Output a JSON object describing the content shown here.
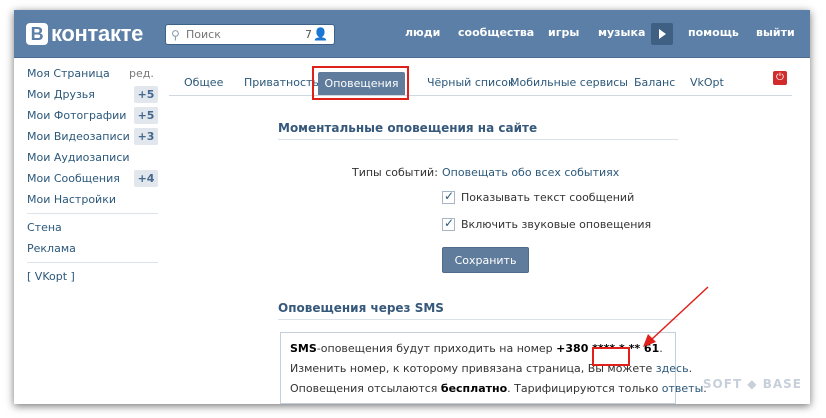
{
  "header": {
    "logo_letter": "В",
    "logo_text": "контакте",
    "search_placeholder": "Поиск",
    "search_count": "7",
    "nav": [
      "люди",
      "сообщества",
      "игры",
      "музыка",
      "помощь",
      "выйти"
    ]
  },
  "sidebar": {
    "edit_label": "ред.",
    "items": [
      {
        "label": "Моя Страница"
      },
      {
        "label": "Мои Друзья",
        "badge": "+5"
      },
      {
        "label": "Мои Фотографии",
        "badge": "+5"
      },
      {
        "label": "Мои Видеозаписи",
        "badge": "+3"
      },
      {
        "label": "Мои Аудиозаписи"
      },
      {
        "label": "Мои Сообщения",
        "badge": "+4"
      },
      {
        "label": "Мои Настройки"
      },
      {
        "label": "Стена"
      },
      {
        "label": "Реклама"
      },
      {
        "label": "[ VKopt ]"
      }
    ]
  },
  "tabs": [
    "Общее",
    "Приватность",
    "Оповещения",
    "Чёрный список",
    "Мобильные сервисы",
    "Баланс",
    "VkOpt"
  ],
  "active_tab": "Оповещения",
  "instant": {
    "title": "Моментальные оповещения на сайте",
    "event_types_label": "Типы событий:",
    "event_types_value": "Оповещать обо всех событиях",
    "show_text_label": "Показывать текст сообщений",
    "sound_label": "Включить звуковые оповещения",
    "save_label": "Сохранить"
  },
  "sms": {
    "title": "Оповещения через SMS",
    "line1_prefix": "SMS",
    "line1_middle": "-оповещения будут приходить на номер ",
    "line1_number": "+380 **** * ** 61",
    "line1_end": ".",
    "line2_text": "Изменить номер, к которому привязана страница, Вы можете ",
    "line2_link": "здесь",
    "line2_end": ".",
    "line3_text": "Оповещения отсылаются ",
    "line3_bold": "бесплатно",
    "line3_mid": ". Тарифицируются только ",
    "line3_link": "ответы",
    "line3_end": "."
  },
  "watermark": "SOFT ◆ BASE",
  "colors": {
    "header": "#5b7fa6",
    "link": "#2b587a",
    "accent": "#5f7c9c",
    "annotation": "#e0201b"
  }
}
